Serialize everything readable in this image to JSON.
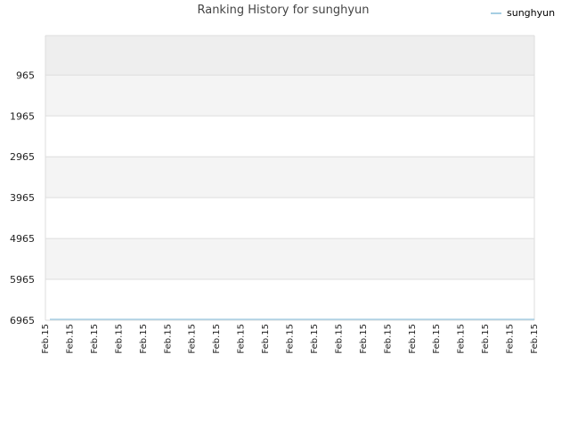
{
  "chart_data": {
    "type": "line",
    "title": "Ranking History for sunghyun",
    "xlabel": "",
    "ylabel": "",
    "y_inverted": true,
    "ylim": [
      0,
      6965
    ],
    "y_ticks": [
      965,
      1965,
      2965,
      3965,
      4965,
      5965,
      6965
    ],
    "x_ticks": [
      "Feb.15",
      "Feb.15",
      "Feb.15",
      "Feb.15",
      "Feb.15",
      "Feb.15",
      "Feb.15",
      "Feb.15",
      "Feb.15",
      "Feb.15",
      "Feb.15",
      "Feb.15",
      "Feb.15",
      "Feb.15",
      "Feb.15",
      "Feb.15",
      "Feb.15",
      "Feb.15",
      "Feb.15",
      "Feb.15",
      "Feb.15"
    ],
    "series": [
      {
        "name": "sunghyun",
        "color": "#a6cee3",
        "values": [
          6965,
          6965,
          6965,
          6965,
          6965,
          6965,
          6965,
          6965,
          6965,
          6965,
          6965,
          6965,
          6965,
          6965,
          6965,
          6965,
          6965,
          6965,
          6965,
          6965,
          6965
        ]
      }
    ],
    "grid": true,
    "band_colors": [
      "#eeeeee",
      "#f4f4f4",
      "#ffffff",
      "#f4f4f4",
      "#ffffff",
      "#f4f4f4",
      "#ffffff"
    ],
    "legend_position": "top-right"
  }
}
